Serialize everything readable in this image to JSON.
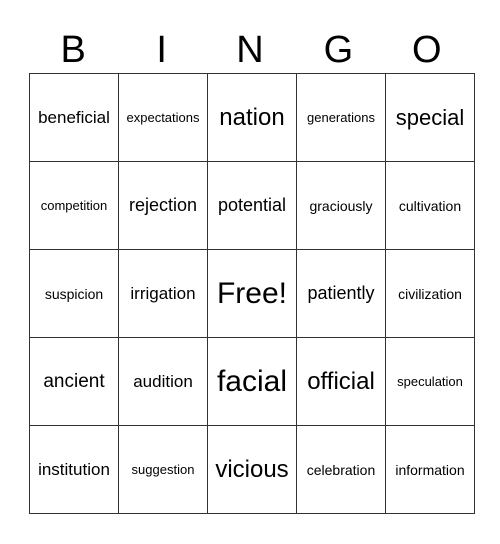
{
  "header": [
    "B",
    "I",
    "N",
    "G",
    "O"
  ],
  "grid": [
    [
      "beneficial",
      "expectations",
      "nation",
      "generations",
      "special"
    ],
    [
      "competition",
      "rejection",
      "potential",
      "graciously",
      "cultivation"
    ],
    [
      "suspicion",
      "irrigation",
      "Free!",
      "patiently",
      "civilization"
    ],
    [
      "ancient",
      "audition",
      "facial",
      "official",
      "speculation"
    ],
    [
      "institution",
      "suggestion",
      "vicious",
      "celebration",
      "information"
    ]
  ]
}
